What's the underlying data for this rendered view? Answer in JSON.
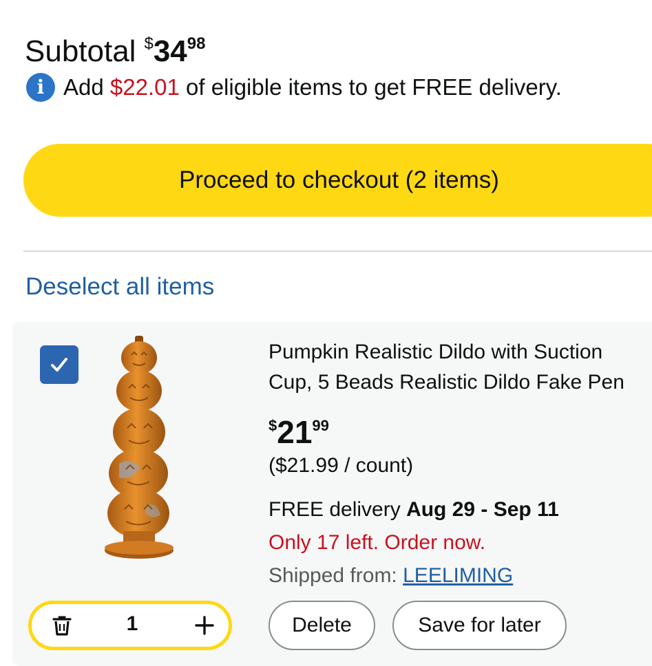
{
  "subtotal": {
    "label": "Subtotal",
    "currency": "$",
    "whole": "34",
    "fraction": "98"
  },
  "free_delivery": {
    "icon": "info-icon",
    "prefix": "Add",
    "amount": "$22.01",
    "suffix": "of eligible items to get FREE delivery."
  },
  "checkout": {
    "label": "Proceed to checkout (2 items)"
  },
  "deselect_label": "Deselect all items",
  "item": {
    "selected": true,
    "title_line1": "Pumpkin Realistic Dildo with Suction",
    "title_line2": "Cup, 5 Beads Realistic Dildo Fake Pen",
    "price_currency": "$",
    "price_whole": "21",
    "price_fraction": "99",
    "unit_price": "($21.99 / count)",
    "delivery_prefix": "FREE delivery",
    "delivery_dates": "Aug 29 - Sep 11",
    "stock": "Only 17 left. Order now.",
    "shipped_label": "Shipped from:",
    "seller": "LEELIMING",
    "quantity": "1",
    "delete_label": "Delete",
    "save_label": "Save for later"
  },
  "colors": {
    "checkout_button": "#ffd814",
    "link": "#1f5fa3",
    "price_alert": "#c7121f",
    "checkbox": "#2c66b0",
    "card_background": "#f6f7f7"
  }
}
